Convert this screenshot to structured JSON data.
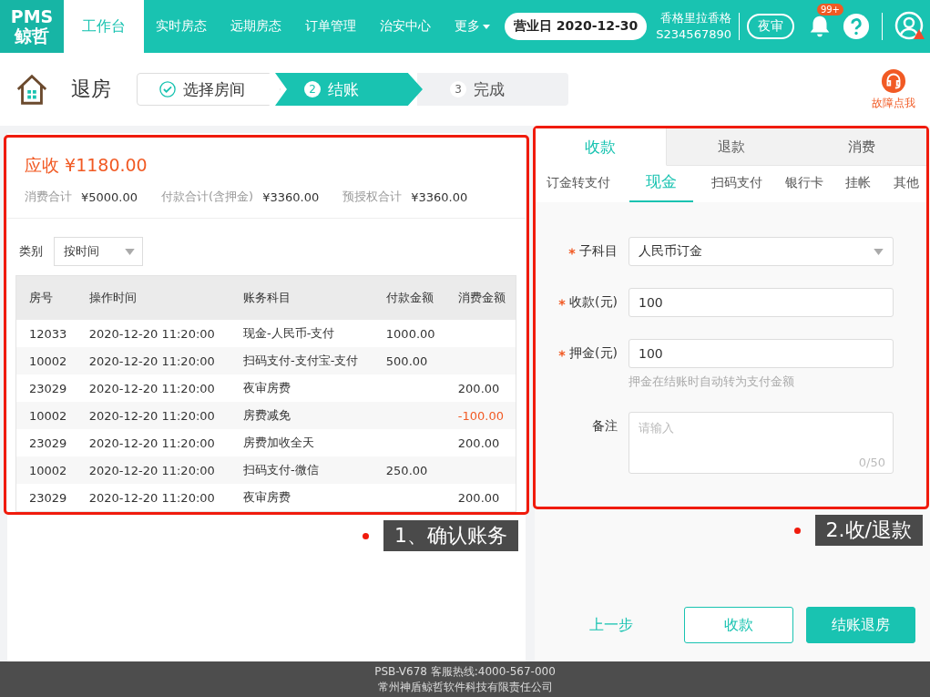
{
  "header": {
    "logo_top": "PMS",
    "logo_bottom": "鲸哲",
    "nav": [
      {
        "label": "工作台",
        "selected": true
      },
      {
        "label": "实时房态",
        "selected": false
      },
      {
        "label": "远期房态",
        "selected": false
      },
      {
        "label": "订单管理",
        "selected": false
      },
      {
        "label": "治安中心",
        "selected": false
      },
      {
        "label": "更多",
        "selected": false,
        "dropdown": true
      }
    ],
    "business_day": "营业日 2020-12-30",
    "hotel_name": "香格里拉香格",
    "hotel_code": "S234567890",
    "night_audit": "夜审",
    "notification_badge": "99+"
  },
  "page": {
    "title": "退房",
    "help": "故障点我",
    "steps": [
      {
        "label": "选择房间",
        "done": true,
        "selected": false
      },
      {
        "number": "2",
        "label": "结账",
        "done": false,
        "selected": true
      },
      {
        "number": "3",
        "label": "完成",
        "done": false,
        "selected": false
      }
    ]
  },
  "bill": {
    "receivable": "应收 ¥1180.00",
    "totals": [
      {
        "label": "消费合计",
        "value": "¥5000.00"
      },
      {
        "label": "付款合计(含押金)",
        "value": "¥3360.00"
      },
      {
        "label": "预授权合计",
        "value": "¥3360.00"
      }
    ],
    "filter_label": "类别",
    "filter_value": "按时间",
    "table": {
      "columns": [
        "房号",
        "操作时间",
        "账务科目",
        "付款金额",
        "消费金额"
      ],
      "rows": [
        {
          "room": "12033",
          "time": "2020-12-20 11:20:00",
          "item": "现金-人民币-支付",
          "payment": "1000.00",
          "consumption": ""
        },
        {
          "room": "10002",
          "time": "2020-12-20 11:20:00",
          "item": "扫码支付-支付宝-支付",
          "payment": "500.00",
          "consumption": ""
        },
        {
          "room": "23029",
          "time": "2020-12-20 11:20:00",
          "item": "夜审房费",
          "payment": "",
          "consumption": "200.00",
          "negative": false
        },
        {
          "room": "10002",
          "time": "2020-12-20 11:20:00",
          "item": "房费减免",
          "payment": "",
          "consumption": "-100.00",
          "negative": true
        },
        {
          "room": "23029",
          "time": "2020-12-20 11:20:00",
          "item": "房费加收全天",
          "payment": "",
          "consumption": "200.00",
          "negative": false
        },
        {
          "room": "10002",
          "time": "2020-12-20 11:20:00",
          "item": "扫码支付-微信",
          "payment": "250.00",
          "consumption": ""
        },
        {
          "room": "23029",
          "time": "2020-12-20 11:20:00",
          "item": "夜审房费",
          "payment": "",
          "consumption": "200.00",
          "negative": false
        }
      ]
    },
    "callout": "1、确认账务"
  },
  "payment": {
    "tabs": [
      {
        "label": "收款",
        "selected": true
      },
      {
        "label": "退款",
        "selected": false
      },
      {
        "label": "消费",
        "selected": false
      }
    ],
    "methods": [
      {
        "label": "订金转支付",
        "selected": false
      },
      {
        "label": "现金",
        "selected": true
      },
      {
        "label": "扫码支付",
        "selected": false
      },
      {
        "label": "银行卡",
        "selected": false
      },
      {
        "label": "挂帐",
        "selected": false
      },
      {
        "label": "其他",
        "selected": false
      }
    ],
    "fields": [
      {
        "label": "子科目",
        "required": true,
        "kind": "select",
        "value": "人民币订金"
      },
      {
        "label": "收款(元)",
        "required": true,
        "kind": "input",
        "value": "100"
      },
      {
        "label": "押金(元)",
        "required": true,
        "kind": "input",
        "value": "100",
        "hint": "押金在结账时自动转为支付金额"
      },
      {
        "label": "备注",
        "required": false,
        "kind": "textarea",
        "placeholder": "请输入",
        "counter": "0/50"
      }
    ],
    "callout": "2.收/退款",
    "prev": "上一步",
    "collect_button": "收款",
    "checkout_button": "结账退房"
  },
  "footer": {
    "line1": "PSB-V678  客服热线:4000-567-000",
    "line2": "常州神盾鲸哲软件科技有限责任公司"
  }
}
